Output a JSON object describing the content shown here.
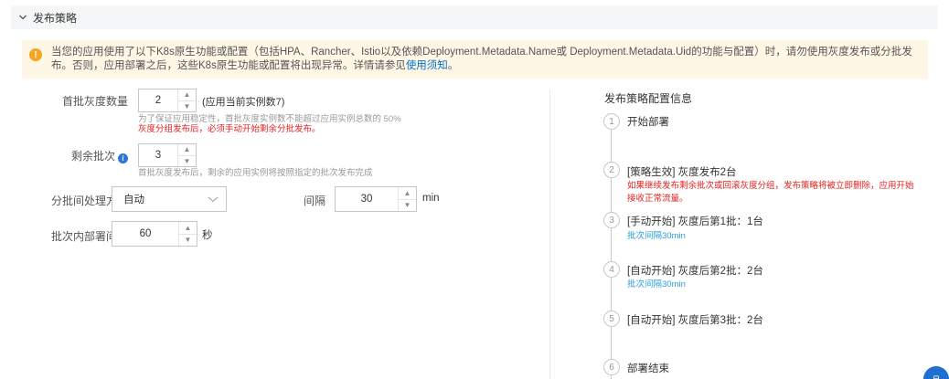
{
  "section": {
    "title": "发布策略"
  },
  "alert": {
    "text_before": "当您的应用使用了以下K8s原生功能或配置（包括HPA、Rancher、Istio以及依赖Deployment.Metadata.Name或 Deployment.Metadata.Uid的功能与配置）时，请勿使用灰度发布或分批发布。否则，应用部署之后，这些K8s原生功能或配置将出现异常。详情请参见",
    "link": "使用须知",
    "text_after": "。"
  },
  "form": {
    "first_batch": {
      "label": "首批灰度数量",
      "value": "2",
      "suffix": "(应用当前实例数7)",
      "help": "为了保证应用稳定性，首批灰度实例数不能超过应用实例总数的 50%",
      "help_red": "灰度分组发布后，必须手动开始剩余分批发布。"
    },
    "remaining_batches": {
      "label": "剩余批次",
      "value": "3",
      "help": "首批灰度发布后，剩余的应用实例将按照指定的批次发布完成"
    },
    "batch_mode": {
      "label": "分批间处理方式",
      "value": "自动"
    },
    "interval": {
      "label": "间隔",
      "value": "30",
      "suffix": "min"
    },
    "deploy_interval": {
      "label": "批次内部署间隔",
      "value": "60",
      "suffix": "秒"
    }
  },
  "panel": {
    "title": "发布策略配置信息",
    "steps": [
      {
        "num": "1",
        "title": "开始部署"
      },
      {
        "num": "2",
        "title": "[策略生效] 灰度发布2台",
        "note": "如果继续发布剩余批次或回滚灰度分组，发布策略将被立即删除，应用开始接收正常流量。"
      },
      {
        "num": "3",
        "title": "[手动开始] 灰度后第1批：1台",
        "sub": "批次间隔30min"
      },
      {
        "num": "4",
        "title": "[自动开始] 灰度后第2批：2台",
        "sub": "批次间隔30min"
      },
      {
        "num": "5",
        "title": "[自动开始] 灰度后第3批：2台"
      },
      {
        "num": "6",
        "title": "部署结束"
      }
    ]
  },
  "fab": {
    "label": "品"
  },
  "colors": {
    "accent": "#2b77d9",
    "warning": "#f5a623",
    "error": "#e62121",
    "link": "#2b9fd9"
  }
}
